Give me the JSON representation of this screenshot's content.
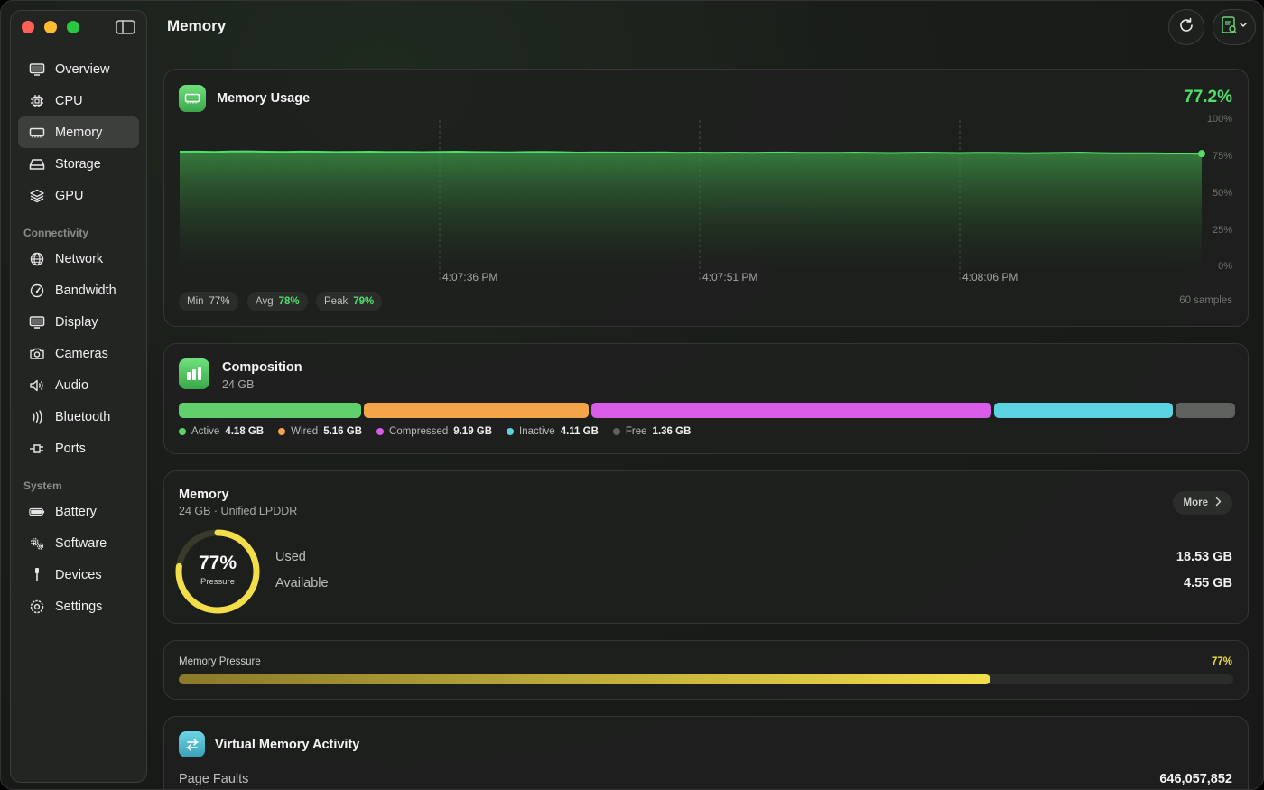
{
  "header": {
    "title": "Memory"
  },
  "sidebar": {
    "items": [
      {
        "label": "Overview",
        "icon": "display-icon"
      },
      {
        "label": "CPU",
        "icon": "cpu-icon"
      },
      {
        "label": "Memory",
        "icon": "memory-icon",
        "active": true
      },
      {
        "label": "Storage",
        "icon": "storage-icon"
      },
      {
        "label": "GPU",
        "icon": "gpu-icon"
      }
    ],
    "sections": [
      {
        "title": "Connectivity",
        "items": [
          {
            "label": "Network",
            "icon": "globe-icon"
          },
          {
            "label": "Bandwidth",
            "icon": "gauge-icon"
          },
          {
            "label": "Display",
            "icon": "display-icon"
          },
          {
            "label": "Cameras",
            "icon": "camera-icon"
          },
          {
            "label": "Audio",
            "icon": "speaker-icon"
          },
          {
            "label": "Bluetooth",
            "icon": "bluetooth-icon"
          },
          {
            "label": "Ports",
            "icon": "port-icon"
          }
        ]
      },
      {
        "title": "System",
        "items": [
          {
            "label": "Battery",
            "icon": "battery-icon"
          },
          {
            "label": "Software",
            "icon": "gears-icon"
          },
          {
            "label": "Devices",
            "icon": "usb-icon"
          },
          {
            "label": "Settings",
            "icon": "gear-icon"
          }
        ]
      }
    ]
  },
  "usage": {
    "title": "Memory Usage",
    "current": "77.2%",
    "yticks": [
      "100%",
      "75%",
      "50%",
      "25%",
      "0%"
    ],
    "xticks": [
      "4:07:36 PM",
      "4:07:51 PM",
      "4:08:06 PM"
    ],
    "min_label": "Min",
    "min": "77%",
    "avg_label": "Avg",
    "avg": "78%",
    "peak_label": "Peak",
    "peak": "79%",
    "samples": "60 samples",
    "accent": "#4ee06a"
  },
  "chart_data": {
    "type": "area",
    "title": "Memory Usage",
    "ylim": [
      0,
      100
    ],
    "x": [
      "4:07:36 PM",
      "4:07:51 PM",
      "4:08:06 PM"
    ],
    "series": [
      {
        "values": [
          78.5,
          78.6,
          78.4,
          78.7,
          78.8,
          78.5,
          78.4,
          78.6,
          78.5,
          78.3,
          78.4,
          78.5,
          78.3,
          78.4,
          78.2,
          78.4,
          78.5,
          78.3,
          78.2,
          78.1,
          78.3,
          78.4,
          78.2,
          77.9,
          78.1,
          78.0,
          77.9,
          78.0,
          78.1,
          77.8,
          77.9,
          77.8,
          77.9,
          77.8,
          77.9,
          78.0,
          77.8,
          77.7,
          77.8,
          77.9,
          77.7,
          77.6,
          77.8,
          77.9,
          77.7,
          77.6,
          77.7,
          77.8,
          77.6,
          77.5,
          77.6,
          77.7,
          77.9,
          77.6,
          77.4,
          77.5,
          77.4,
          77.3,
          77.3,
          77.2
        ]
      }
    ]
  },
  "composition": {
    "title": "Composition",
    "total": "24 GB",
    "segments": [
      {
        "label": "Active",
        "value": "4.18 GB",
        "gb": 4.18,
        "color": "#5fd06c"
      },
      {
        "label": "Wired",
        "value": "5.16 GB",
        "gb": 5.16,
        "color": "#f4a54a"
      },
      {
        "label": "Compressed",
        "value": "9.19 GB",
        "gb": 9.19,
        "color": "#d85ce8"
      },
      {
        "label": "Inactive",
        "value": "4.11 GB",
        "gb": 4.11,
        "color": "#5bd3e0"
      },
      {
        "label": "Free",
        "value": "1.36 GB",
        "gb": 1.36,
        "color": "#5f615f"
      }
    ]
  },
  "memory": {
    "title": "Memory",
    "subtitle": "24 GB · Unified LPDDR",
    "more_label": "More",
    "pressure_value": "77%",
    "pressure_label": "Pressure",
    "pressure_fraction": 0.77,
    "used_label": "Used",
    "used": "18.53 GB",
    "available_label": "Available",
    "available": "4.55 GB",
    "gauge_color": "#f3de4a"
  },
  "pressure": {
    "label": "Memory Pressure",
    "value": "77%",
    "fraction": 0.77
  },
  "vm": {
    "title": "Virtual Memory Activity",
    "page_faults_label": "Page Faults",
    "page_faults": "646,057,852"
  }
}
